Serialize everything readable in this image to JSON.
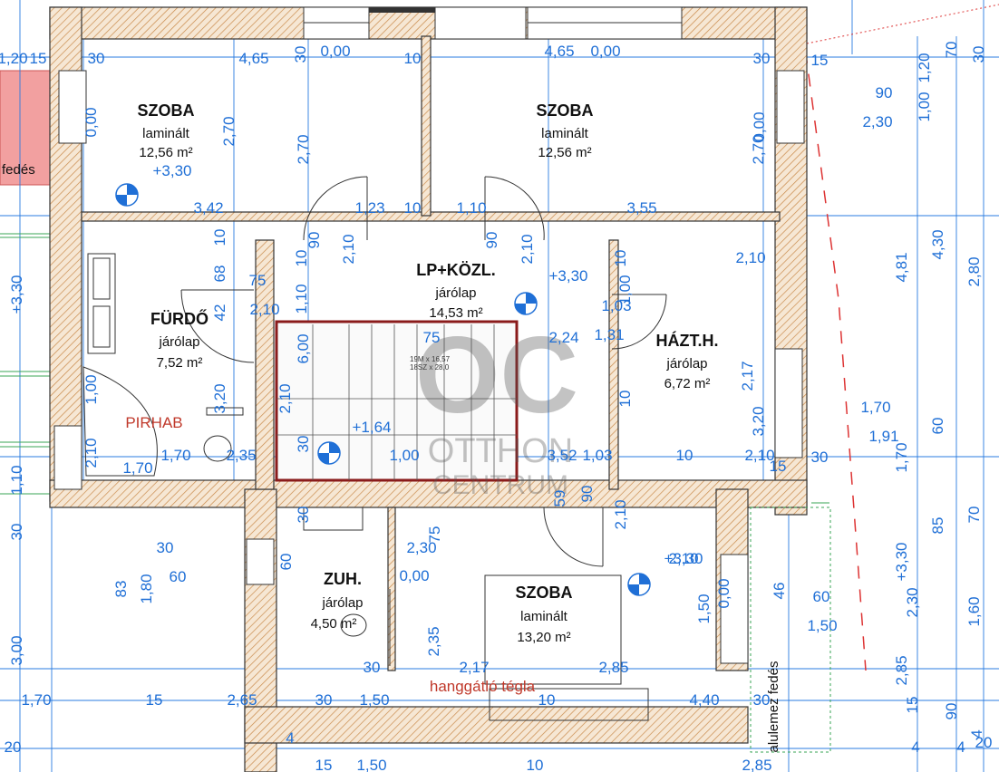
{
  "rooms": [
    {
      "id": "szoba-nw",
      "name": "SZOBA",
      "floor": "laminált",
      "area": "12,56 m²",
      "level": "+3,30"
    },
    {
      "id": "szoba-ne",
      "name": "SZOBA",
      "floor": "laminált",
      "area": "12,56 m²"
    },
    {
      "id": "lp",
      "name": "LP+KÖZL.",
      "floor": "járólap",
      "area": "14,53 m²",
      "level": "+3,30"
    },
    {
      "id": "furdo",
      "name": "FÜRDŐ",
      "floor": "járólap",
      "area": "7,52 m²"
    },
    {
      "id": "haztart",
      "name": "HÁZT.H.",
      "floor": "járólap",
      "area": "6,72 m²"
    },
    {
      "id": "zuh",
      "name": "ZUH.",
      "floor": "járólap",
      "area": "4,50 m²"
    },
    {
      "id": "szoba-s",
      "name": "SZOBA",
      "floor": "laminált",
      "area": "13,20 m²",
      "level": "+3,30"
    }
  ],
  "labels": {
    "pirhab": "PIRHAB",
    "hanggatlo": "hanggátló tégla",
    "stair_level": "+1,64",
    "stair_info1": "19M x 16,57",
    "stair_info2": "18SZ x 28,0",
    "alulemez": "alulemez fedés",
    "fedes": "fedés",
    "watermark_top": "OC",
    "watermark_mid": "OTTHON",
    "watermark_bot": "CENTRUM"
  },
  "dimensions": [
    {
      "t": "1,20"
    },
    {
      "t": "15"
    },
    {
      "t": "30"
    },
    {
      "t": "4,65"
    },
    {
      "t": "30"
    },
    {
      "t": "0,00"
    },
    {
      "t": "10"
    },
    {
      "t": "4,65"
    },
    {
      "t": "0,00"
    },
    {
      "t": "30"
    },
    {
      "t": "15"
    },
    {
      "t": "90"
    },
    {
      "t": "2,30"
    },
    {
      "t": "1,20"
    },
    {
      "t": "70"
    },
    {
      "t": "30"
    },
    {
      "t": "1,00"
    },
    {
      "t": "0,00"
    },
    {
      "t": "0,00"
    },
    {
      "t": "2,70"
    },
    {
      "t": "2,70"
    },
    {
      "t": "2,70"
    },
    {
      "t": "3,42"
    },
    {
      "t": "1,23"
    },
    {
      "t": "10"
    },
    {
      "t": "1,10"
    },
    {
      "t": "3,55"
    },
    {
      "t": "90"
    },
    {
      "t": "2,10"
    },
    {
      "t": "90"
    },
    {
      "t": "2,10"
    },
    {
      "t": "10"
    },
    {
      "t": "10"
    },
    {
      "t": "10"
    },
    {
      "t": "68"
    },
    {
      "t": "75"
    },
    {
      "t": "42"
    },
    {
      "t": "2,10"
    },
    {
      "t": "1,10"
    },
    {
      "t": "1,00"
    },
    {
      "t": "1,03"
    },
    {
      "t": "75"
    },
    {
      "t": "2,24"
    },
    {
      "t": "1,31"
    },
    {
      "t": "2,10"
    },
    {
      "t": "+3,30"
    },
    {
      "t": "4,81"
    },
    {
      "t": "4,30"
    },
    {
      "t": "2,80"
    },
    {
      "t": "6,00"
    },
    {
      "t": "1,00"
    },
    {
      "t": "3,20"
    },
    {
      "t": "2,10"
    },
    {
      "t": "10"
    },
    {
      "t": "2,17"
    },
    {
      "t": "3,20"
    },
    {
      "t": "1,70"
    },
    {
      "t": "1,91"
    },
    {
      "t": "60"
    },
    {
      "t": "2,10"
    },
    {
      "t": "1,70"
    },
    {
      "t": "1,70"
    },
    {
      "t": "2,35"
    },
    {
      "t": "30"
    },
    {
      "t": "1,00"
    },
    {
      "t": "3,52"
    },
    {
      "t": "1,03"
    },
    {
      "t": "10"
    },
    {
      "t": "2,10"
    },
    {
      "t": "30"
    },
    {
      "t": "15"
    },
    {
      "t": "1,70"
    },
    {
      "t": "1,10"
    },
    {
      "t": "59"
    },
    {
      "t": "90"
    },
    {
      "t": "2,10"
    },
    {
      "t": "30"
    },
    {
      "t": "30"
    },
    {
      "t": "85"
    },
    {
      "t": "70"
    },
    {
      "t": "30"
    },
    {
      "t": "60"
    },
    {
      "t": "2,30"
    },
    {
      "t": "75"
    },
    {
      "t": "83"
    },
    {
      "t": "1,80"
    },
    {
      "t": "60"
    },
    {
      "t": "0,00"
    },
    {
      "t": "2,10"
    },
    {
      "t": "+3,30"
    },
    {
      "t": "1,50"
    },
    {
      "t": "0,00"
    },
    {
      "t": "46"
    },
    {
      "t": "60"
    },
    {
      "t": "1,50"
    },
    {
      "t": "2,30"
    },
    {
      "t": "1,60"
    },
    {
      "t": "3,00"
    },
    {
      "t": "2,35"
    },
    {
      "t": "2,17"
    },
    {
      "t": "30"
    },
    {
      "t": "2,85"
    },
    {
      "t": "2,85"
    },
    {
      "t": "1,70"
    },
    {
      "t": "15"
    },
    {
      "t": "2,65"
    },
    {
      "t": "30"
    },
    {
      "t": "1,50"
    },
    {
      "t": "10"
    },
    {
      "t": "4,40"
    },
    {
      "t": "30"
    },
    {
      "t": "15"
    },
    {
      "t": "90"
    },
    {
      "t": "20"
    },
    {
      "t": "4"
    },
    {
      "t": "4"
    },
    {
      "t": "4"
    },
    {
      "t": "4"
    },
    {
      "t": "20"
    },
    {
      "t": "15"
    },
    {
      "t": "1,50"
    },
    {
      "t": "10"
    },
    {
      "t": "2,85"
    },
    {
      "t": "15"
    }
  ],
  "colors": {
    "dimension": "#1f6fd6",
    "wall_hatch": "#c98a4b",
    "red": "#c0392b",
    "pink": "#f2a0a0",
    "green": "#3aa655"
  }
}
